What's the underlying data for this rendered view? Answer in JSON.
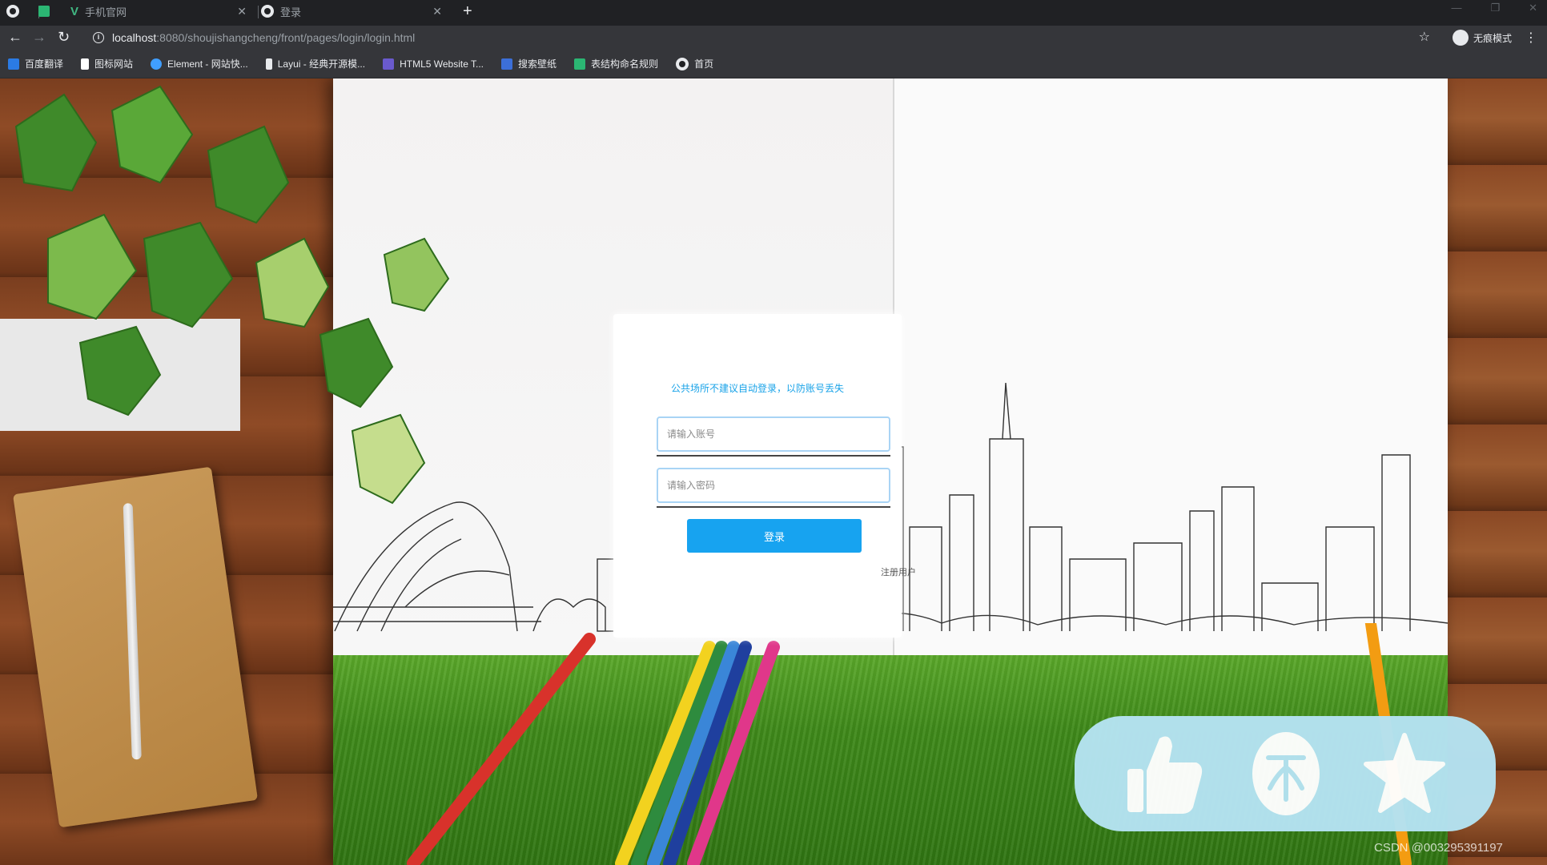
{
  "browser": {
    "tabs": [
      {
        "title": "",
        "icon": "globe-icon"
      },
      {
        "title": "手机官网",
        "icon": "vue-icon"
      },
      {
        "title": "登录",
        "icon": "globe-icon"
      }
    ],
    "url_host": "localhost",
    "url_rest": ":8080/shoujishangcheng/front/pages/login/login.html",
    "profile_label": "无痕模式",
    "bookmarks": [
      {
        "label": "百度翻译",
        "color": "#2b7be4"
      },
      {
        "label": "图标网站",
        "color": "#ffffff"
      },
      {
        "label": "Element - 网站快...",
        "color": "#409eff"
      },
      {
        "label": "Layui - 经典开源模...",
        "color": "#e8eaed"
      },
      {
        "label": "HTML5 Website T...",
        "color": "#6a5acd"
      },
      {
        "label": "搜索壁纸",
        "color": "#3c6fd8"
      },
      {
        "label": "表结构命名规则",
        "color": "#2bb673"
      },
      {
        "label": "首页",
        "color": "#e8eaed"
      }
    ]
  },
  "login": {
    "tip": "公共场所不建议自动登录，以防账号丢失",
    "username_placeholder": "请输入账号",
    "password_placeholder": "请输入密码",
    "login_label": "登录",
    "register_label": "注册用户"
  },
  "overlay": {
    "actions": [
      "like-icon",
      "coin-icon",
      "favorite-icon"
    ]
  },
  "watermark": "CSDN @003295391197",
  "colors": {
    "accent": "#17a3f0",
    "tip_text": "#1aa3e8",
    "overlay_bg": "#b5e3f2"
  }
}
